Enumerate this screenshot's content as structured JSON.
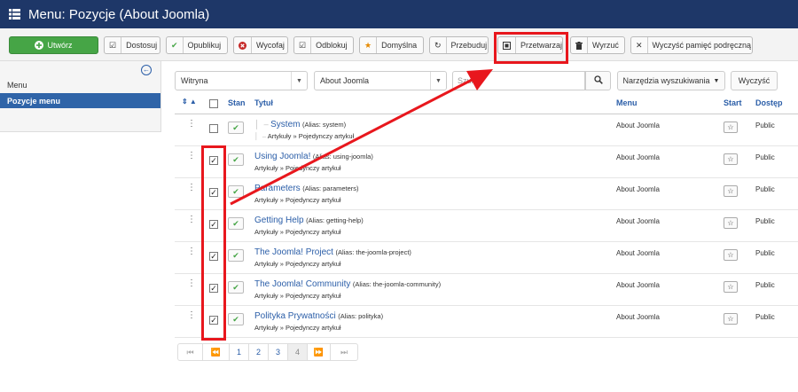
{
  "header": {
    "title": "Menu: Pozycje (About Joomla)"
  },
  "toolbar": {
    "create": "Utwórz",
    "customize": "Dostosuj",
    "publish": "Opublikuj",
    "unpublish": "Wycofaj",
    "checkin": "Odblokuj",
    "default": "Domyślna",
    "rebuild": "Przebuduj",
    "batch": "Przetwarzaj",
    "trash": "Wyrzuć",
    "clear_cache": "Wyczyść pamięć podręczną"
  },
  "sidebar": {
    "heading": "Menu",
    "active_item": "Pozycje menu"
  },
  "filters": {
    "site_select": "Witryna",
    "menu_select": "About Joomla",
    "search_placeholder": "Szukaj",
    "tools_button": "Narzędzia wyszukiwania",
    "clear_button": "Wyczyść"
  },
  "table": {
    "headers": {
      "state": "Stan",
      "title": "Tytuł",
      "menu": "Menu",
      "home": "Start",
      "access": "Dostęp"
    },
    "rows": [
      {
        "title": "System",
        "alias": "(Alias: system)",
        "path": "Artykuły » Pojedynczy artykuł",
        "menu": "About Joomla",
        "access": "Public",
        "checked": false,
        "indent": true
      },
      {
        "title": "Using Joomla!",
        "alias": "(Alias: using-joomla)",
        "path": "Artykuły » Pojedynczy artykuł",
        "menu": "About Joomla",
        "access": "Public",
        "checked": true,
        "indent": false
      },
      {
        "title": "Parameters",
        "alias": "(Alias: parameters)",
        "path": "Artykuły » Pojedynczy artykuł",
        "menu": "About Joomla",
        "access": "Public",
        "checked": true,
        "indent": false
      },
      {
        "title": "Getting Help",
        "alias": "(Alias: getting-help)",
        "path": "Artykuły » Pojedynczy artykuł",
        "menu": "About Joomla",
        "access": "Public",
        "checked": true,
        "indent": false
      },
      {
        "title": "The Joomla! Project",
        "alias": "(Alias: the-joomla-project)",
        "path": "Artykuły » Pojedynczy artykuł",
        "menu": "About Joomla",
        "access": "Public",
        "checked": true,
        "indent": false
      },
      {
        "title": "The Joomla! Community",
        "alias": "(Alias: the-joomla-community)",
        "path": "Artykuły » Pojedynczy artykuł",
        "menu": "About Joomla",
        "access": "Public",
        "checked": true,
        "indent": false
      },
      {
        "title": "Polityka Prywatności",
        "alias": "(Alias: polityka)",
        "path": "Artykuły » Pojedynczy artykuł",
        "menu": "About Joomla",
        "access": "Public",
        "checked": true,
        "indent": false
      }
    ]
  },
  "pagination": {
    "pages": [
      "1",
      "2",
      "3",
      "4"
    ],
    "current": "4"
  },
  "colors": {
    "header_bg": "#1e3768",
    "accent": "#2f64a8",
    "create_green": "#46a546",
    "annotation_red": "#e8171d"
  }
}
